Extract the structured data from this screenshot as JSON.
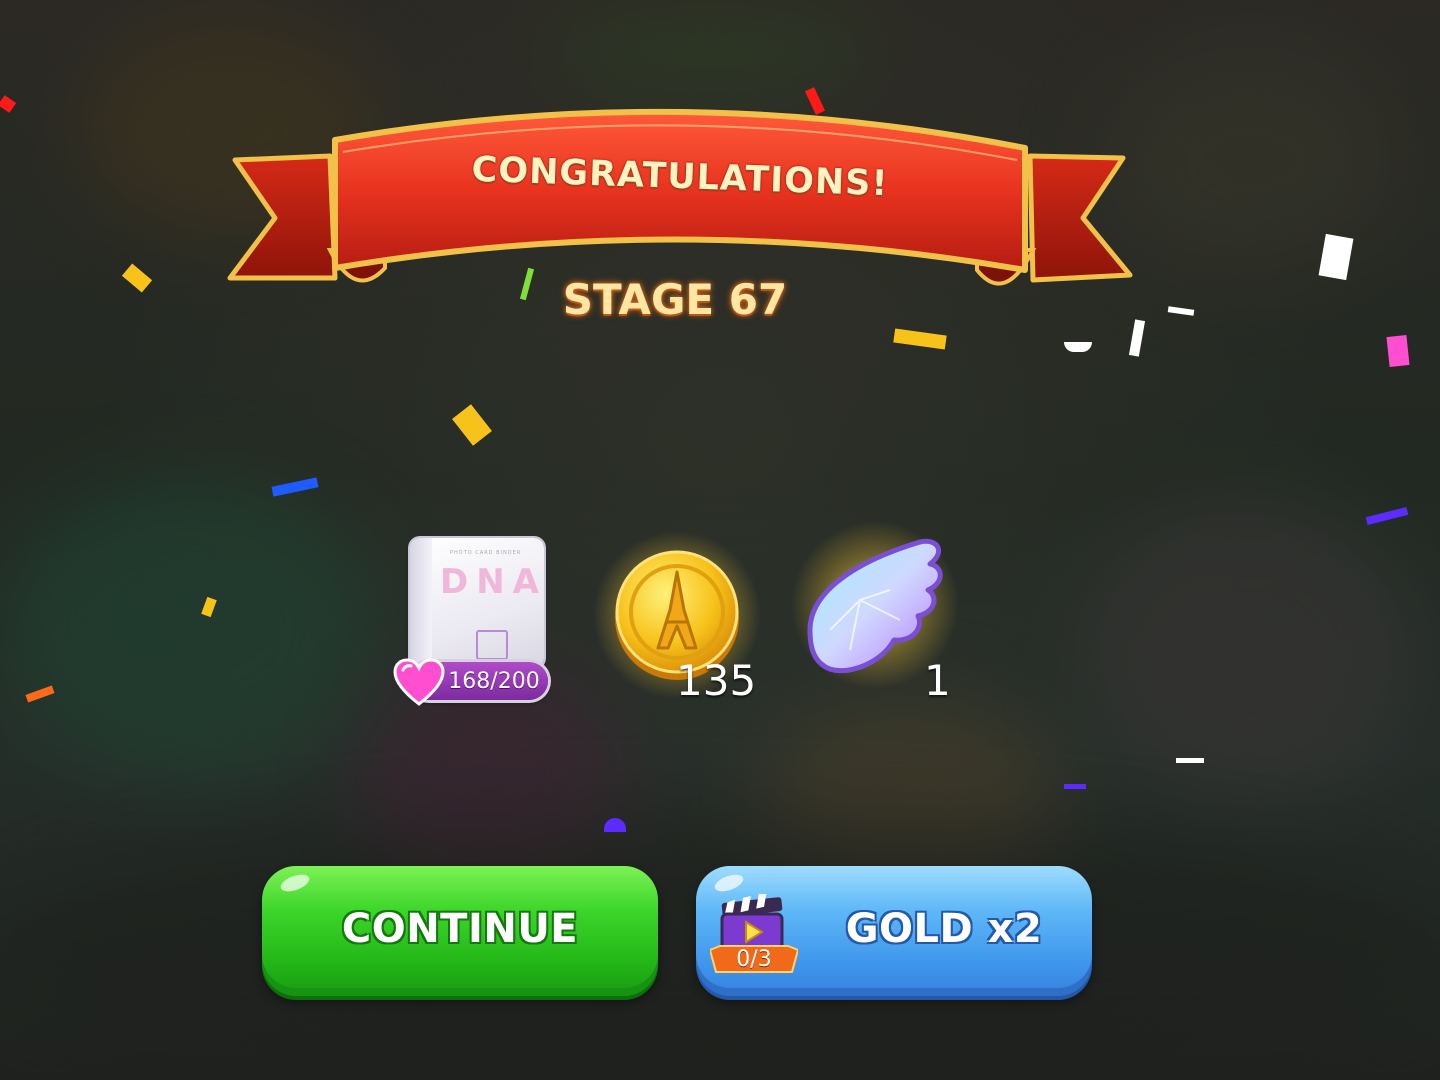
{
  "banner": {
    "title": "CONGRATULATIONS!"
  },
  "stage": {
    "label": "STAGE 67"
  },
  "rewards": {
    "card": {
      "title": "DNA",
      "subtitle": "PHOTO CARD BINDER",
      "progress": "168/200"
    },
    "gold": {
      "count": "135",
      "icon": "eiffel-coin-icon"
    },
    "wing": {
      "count": "1",
      "icon": "crystal-wing-icon"
    }
  },
  "buttons": {
    "continue_label": "CONTINUE",
    "gold_label": "GOLD x2",
    "video_count": "0/3",
    "video_icon": "clapperboard-play-icon"
  },
  "colors": {
    "ribbon_red": "#e8331f",
    "ribbon_gold": "#f2c14a",
    "continue_green": "#34cc22",
    "gold_blue": "#4ea6f2",
    "stage_text": "#ffe6a3"
  }
}
